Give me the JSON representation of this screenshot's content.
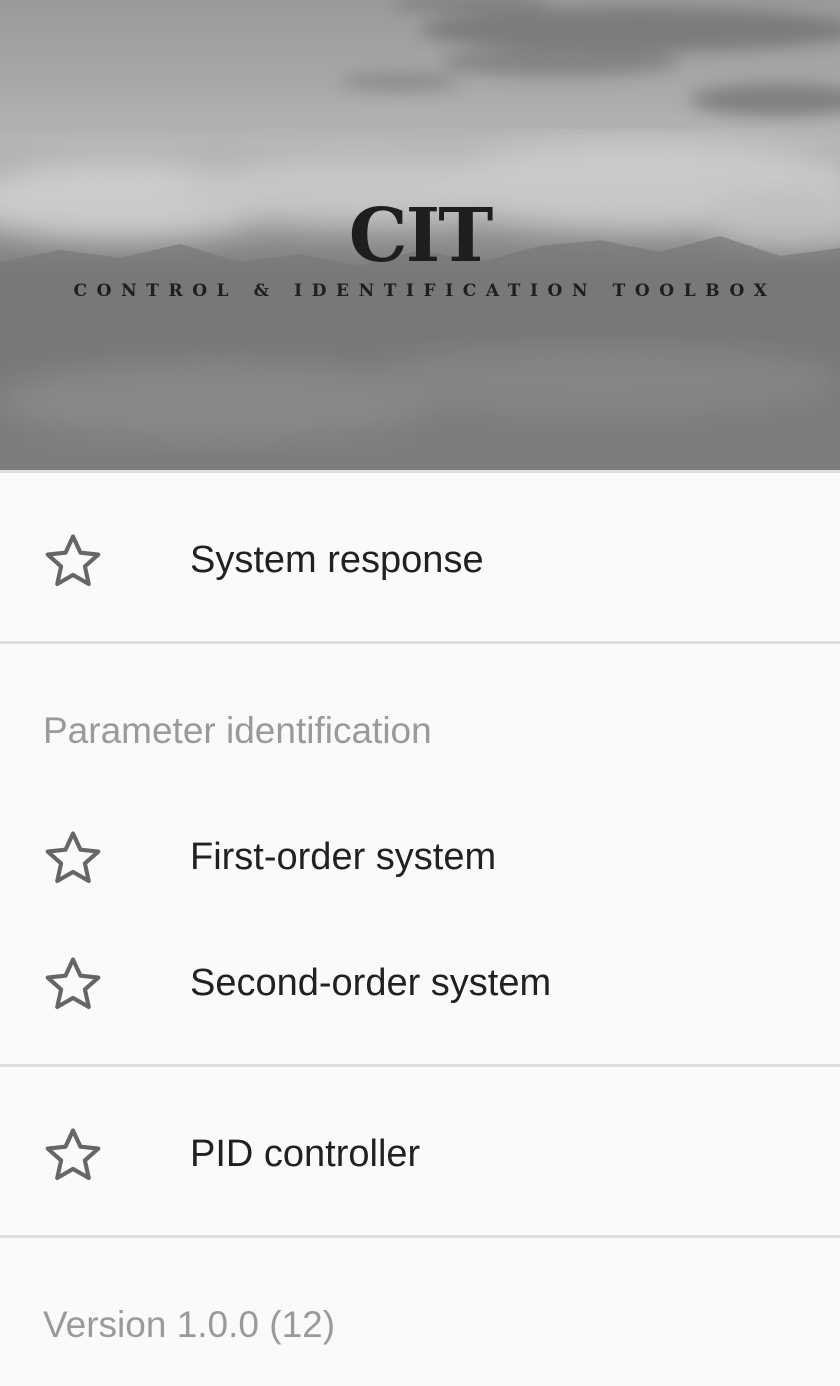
{
  "header": {
    "logo_text": "CIT",
    "logo_subtitle": "CONTROL & IDENTIFICATION TOOLBOX"
  },
  "menu": {
    "system_response": {
      "label": "System response",
      "icon": "star-outline-icon"
    },
    "parameter_identification": {
      "header": "Parameter identification",
      "items": [
        {
          "label": "First-order system",
          "icon": "star-outline-icon"
        },
        {
          "label": "Second-order system",
          "icon": "star-outline-icon"
        }
      ]
    },
    "pid_controller": {
      "label": "PID controller",
      "icon": "star-outline-icon"
    }
  },
  "footer": {
    "version": "Version 1.0.0 (12)"
  },
  "colors": {
    "background": "#fafafa",
    "primary_text": "#212121",
    "secondary_text": "#9a9a9a",
    "divider": "#dedede",
    "icon": "#666666"
  }
}
